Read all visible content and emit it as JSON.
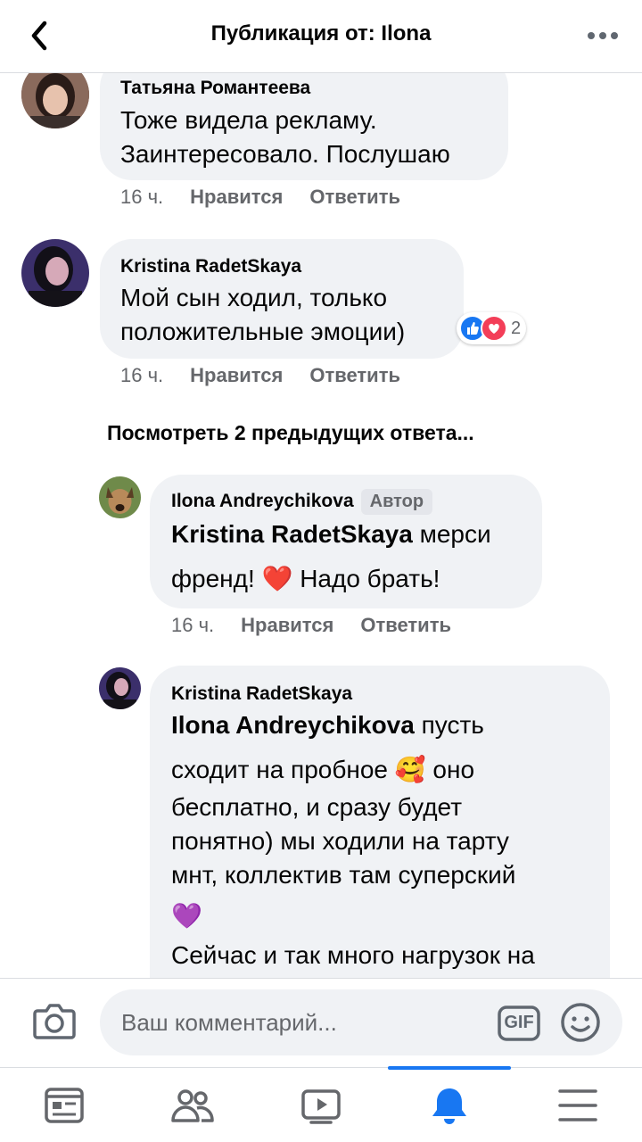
{
  "header": {
    "title": "Публикация от: Ilona",
    "back_icon": "chevron-left-icon",
    "more_icon": "more-horizontal-icon"
  },
  "comments": [
    {
      "author": "Татьяна Романтеева",
      "text_lines": [
        "Тоже видела рекламу.",
        "Заинтересовало. Послушаю"
      ],
      "time": "16 ч.",
      "like_label": "Нравится",
      "reply_label": "Ответить"
    },
    {
      "author": "Kristina RadetSkaya",
      "text_lines": [
        "Мой сын ходил, только",
        "положительные эмоции)"
      ],
      "time": "16 ч.",
      "like_label": "Нравится",
      "reply_label": "Ответить",
      "reactions": {
        "icons": [
          "like-icon",
          "love-icon"
        ],
        "count": "2"
      }
    }
  ],
  "view_previous_replies": "Посмотреть 2 предыдущих ответа...",
  "replies": [
    {
      "author": "Ilona Andreychikova",
      "badge": "Автор",
      "mention": "Kristina RadetSkaya",
      "text_after_mention": " мерси",
      "line2_a": "френд! ",
      "line2_emoji": "❤️",
      "line2_b": " Надо брать!",
      "time": "16 ч.",
      "like_label": "Нравится",
      "reply_label": "Ответить"
    },
    {
      "author": "Kristina RadetSkaya",
      "mention": "Ilona Andreychikova",
      "text_after_mention": " пусть",
      "line2_a": "сходит на пробное ",
      "line2_emoji": "🥰",
      "line2_b": " оно",
      "line3": "бесплатно, и сразу будет",
      "line4": "понятно) мы ходили на тарту",
      "line5": "мнт,  коллектив там суперский",
      "line6_emoji": "💜",
      "line7": "Сейчас и так много нагрузок на"
    }
  ],
  "composer": {
    "placeholder": "Ваш комментарий...",
    "camera_icon": "camera-icon",
    "gif_label": "GIF",
    "emoji_icon": "emoji-icon"
  },
  "bottom_nav": {
    "items": [
      "feed-icon",
      "friends-icon",
      "watch-icon",
      "notifications-icon",
      "menu-icon"
    ],
    "active": "notifications-icon"
  },
  "colors": {
    "accent": "#1877f2",
    "bubble": "#f0f2f5",
    "secondary_text": "#65676b",
    "love": "#f33e58"
  }
}
